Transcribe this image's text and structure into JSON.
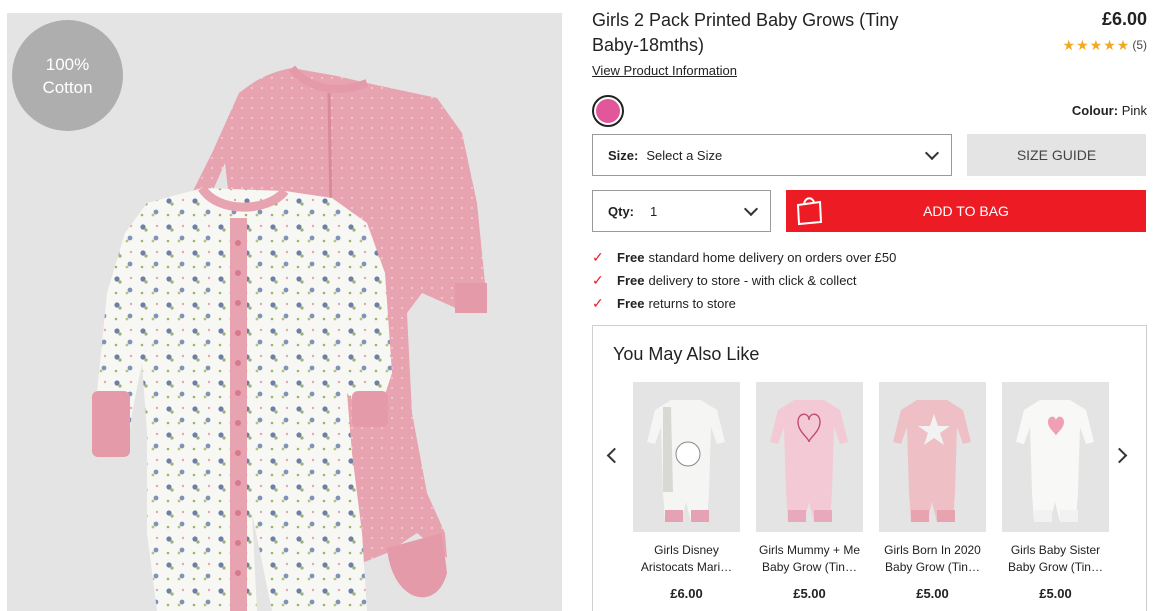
{
  "product": {
    "title": "Girls 2 Pack Printed Baby Grows (Tiny Baby-18mths)",
    "price": "£6.00",
    "rating_stars": 5,
    "rating_count": "(5)",
    "view_info": "View Product Information",
    "badge_line1": "100%",
    "badge_line2": "Cotton",
    "colour_label": "Colour:",
    "colour_value": "Pink",
    "swatch_color": "#e2579a"
  },
  "size_select": {
    "label": "Size:",
    "value": "Select a Size"
  },
  "size_guide": "SIZE GUIDE",
  "qty_select": {
    "label": "Qty:",
    "value": "1"
  },
  "add_to_bag": "ADD TO BAG",
  "perks": [
    {
      "bold": "Free",
      "text": "standard home delivery on orders over £50"
    },
    {
      "bold": "Free",
      "text": "delivery to store - with click & collect"
    },
    {
      "bold": "Free",
      "text": "returns to store"
    }
  ],
  "ymal": {
    "title": "You May Also Like",
    "items": [
      {
        "name": "Girls Disney\nAristocats Mari…",
        "price": "£6.00"
      },
      {
        "name": "Girls Mummy + Me\nBaby Grow (Tin…",
        "price": "£5.00"
      },
      {
        "name": "Girls Born In 2020\nBaby Grow (Tin…",
        "price": "£5.00"
      },
      {
        "name": "Girls Baby Sister\nBaby Grow (Tin…",
        "price": "£5.00"
      }
    ]
  },
  "colors": {
    "accent_red": "#ed1c24",
    "star": "#f3a81d"
  }
}
